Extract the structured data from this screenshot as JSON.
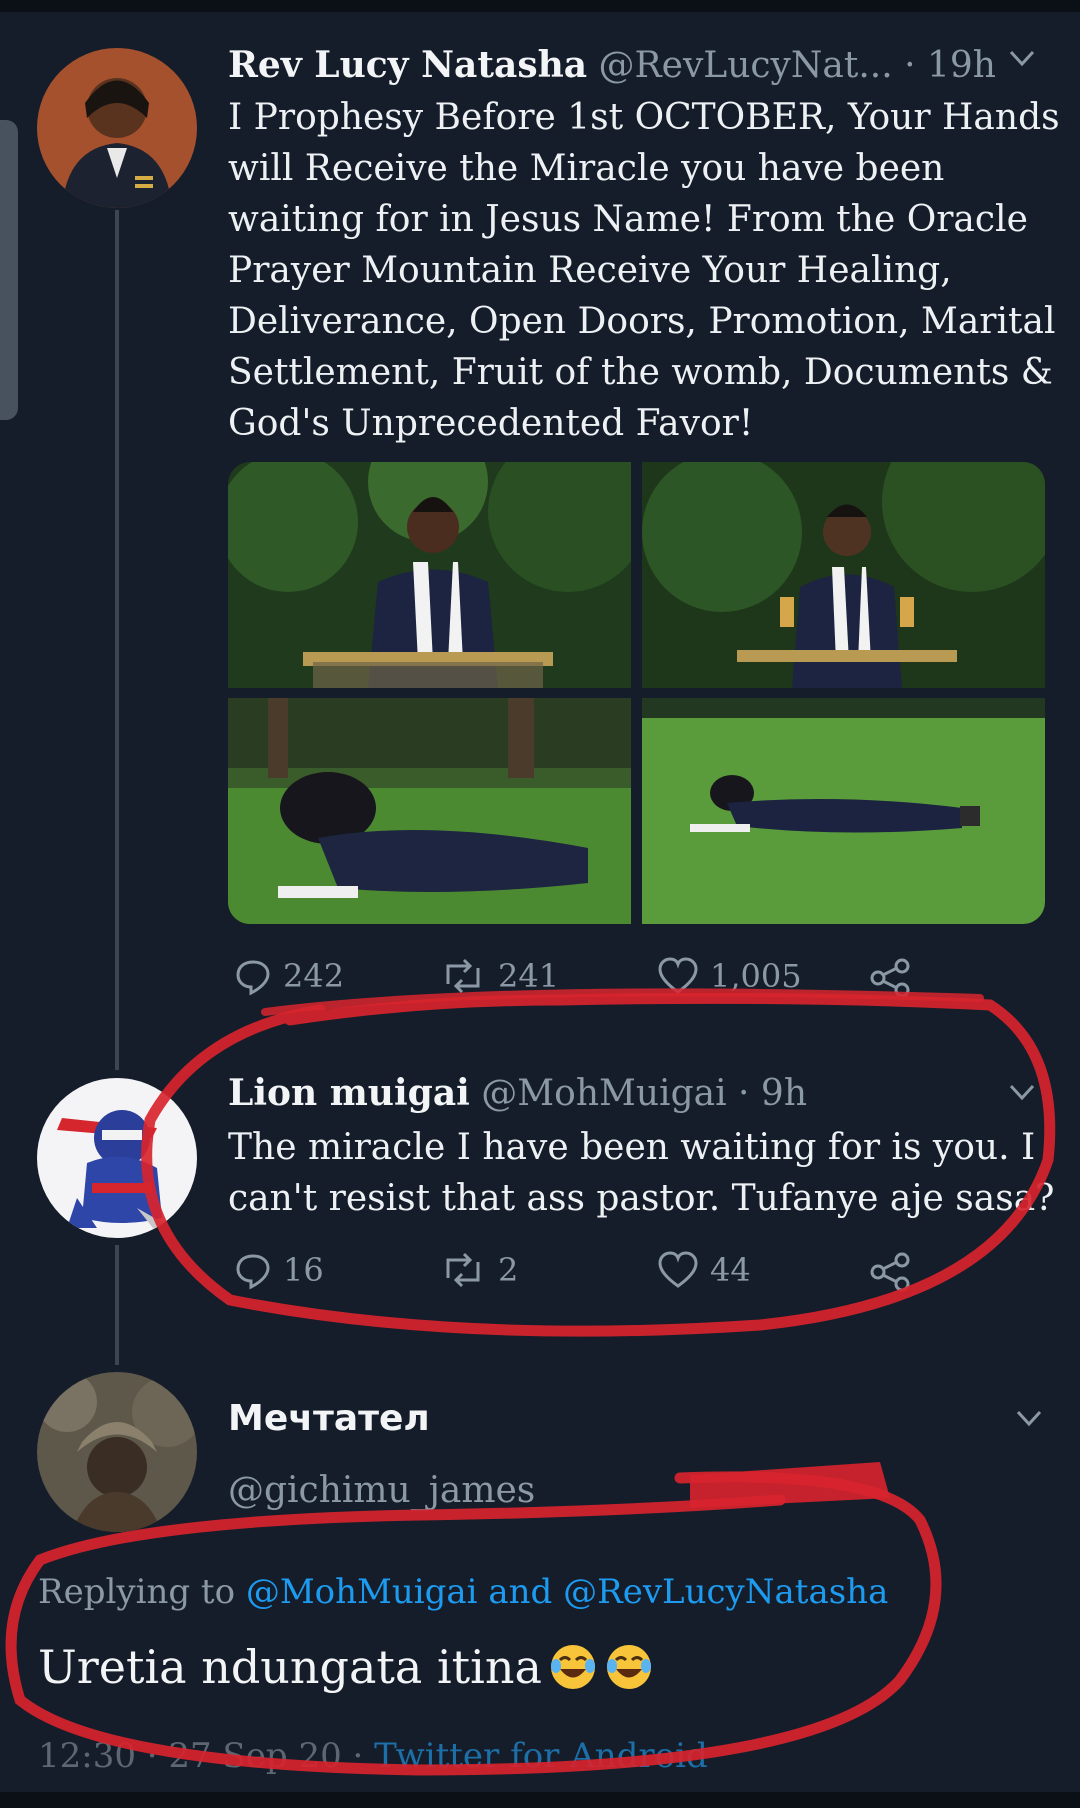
{
  "tweet1": {
    "name": "Rev Lucy Natasha",
    "handle": "@RevLucyNat...",
    "time": "· 19h",
    "lines": [
      "I Prophesy Before 1st OCTOBER, Your Hands",
      "will Receive the Miracle you have been",
      "waiting for in Jesus Name! From the Oracle",
      "Prayer Mountain Receive Your Healing,",
      "Deliverance, Open Doors,  Promotion,  Marital",
      "Settlement,  Fruit of the womb, Documents &",
      "God's Unprecedented Favor!"
    ],
    "replies": "242",
    "retweets": "241",
    "likes": "1,005"
  },
  "tweet2": {
    "name": "Lion muigai",
    "handle": "@MohMuigai",
    "time": "· 9h",
    "lines": [
      "The miracle I have been waiting for is you. I",
      "can't resist that ass pastor. Tufanye aje sasa?"
    ],
    "replies": "16",
    "retweets": "2",
    "likes": "44"
  },
  "tweet3": {
    "name": "Мечтател",
    "handle": "@gichimu_james",
    "replying_prefix": "Replying to",
    "mention1": "@MohMuigai",
    "and_word": "and",
    "mention2": "@RevLucyNatasha",
    "text": "Uretia ndungata itina",
    "meta_time": "12:30 · 27 Sep 20 ·",
    "meta_client": "Twitter for Android"
  },
  "icons": {
    "reply": "reply-icon",
    "retweet": "retweet-icon",
    "like": "heart-icon",
    "share": "share-icon",
    "more": "chevron-down-icon",
    "emoji": "tears-of-joy-emoji"
  },
  "colors": {
    "background": "#151d2a",
    "link": "#1d9bf0",
    "muted": "#8b98a5",
    "annotation": "#d8242e"
  }
}
